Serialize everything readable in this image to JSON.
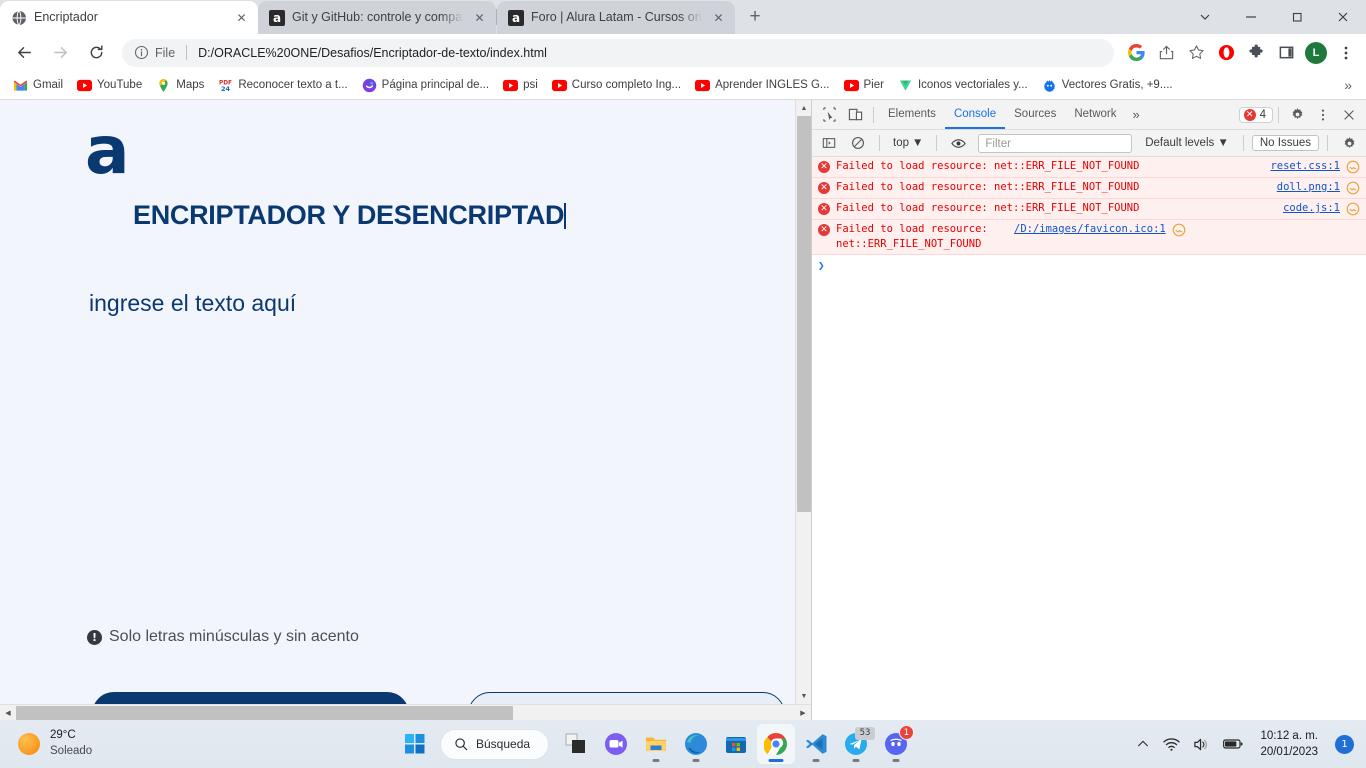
{
  "browser": {
    "tabs": [
      {
        "title": "Encriptador",
        "favicon": "globe-icon",
        "active": true
      },
      {
        "title": "Git y GitHub: controle y compartä",
        "favicon": "alura-icon",
        "active": false
      },
      {
        "title": "Foro | Alura Latam - Cursos onlin",
        "favicon": "alura-icon",
        "active": false
      }
    ],
    "new_tab_label": "+",
    "window_controls": {
      "minimize": "–",
      "maximize": "❐",
      "close": "✕",
      "chevron": "⌄"
    },
    "nav": {
      "back": "←",
      "forward": "→",
      "reload": "⟳"
    },
    "omnibox": {
      "info_icon": "info-circle-icon",
      "scheme_label": "File",
      "url": "D:/ORACLE%20ONE/Desafios/Encriptador-de-texto/index.html"
    },
    "toolbar_icons": [
      "google-icon",
      "share-icon",
      "bookmark-star-icon",
      "opera-gx-icon",
      "extensions-puzzle-icon",
      "side-panel-icon"
    ],
    "profile_initial": "L",
    "menu_icon": "three-dots-icon",
    "bookmarks": [
      {
        "label": "Gmail",
        "icon": "gmail-icon"
      },
      {
        "label": "YouTube",
        "icon": "youtube-icon"
      },
      {
        "label": "Maps",
        "icon": "maps-pin-icon"
      },
      {
        "label": "Reconocer texto a t...",
        "icon": "pdf24-icon"
      },
      {
        "label": "Página principal de...",
        "icon": "purple-circle-icon"
      },
      {
        "label": "psi",
        "icon": "youtube-icon"
      },
      {
        "label": "Curso completo Ing...",
        "icon": "youtube-icon"
      },
      {
        "label": "Aprender INGLES G...",
        "icon": "youtube-icon"
      },
      {
        "label": "Pier",
        "icon": "youtube-icon"
      },
      {
        "label": "Iconos vectoriales y...",
        "icon": "vuesax-icon"
      },
      {
        "label": "Vectores Gratis, +9....",
        "icon": "freepik-icon"
      }
    ],
    "bookmarks_overflow": "»"
  },
  "page": {
    "logo_letter": "a",
    "title": "ENCRIPTADOR Y DESENCRIPTAD",
    "input_value": "ingrese el texto aquí",
    "hint_icon": "exclamation-circle-icon",
    "hint_text": "Solo letras minúsculas y sin acento",
    "buttons": {
      "encrypt": "",
      "decrypt": ""
    },
    "colors": {
      "brand_blue": "#0a3871",
      "page_bg": "#f3f5fc"
    }
  },
  "devtools": {
    "inspect_icon": "cursor-select-icon",
    "device_icon": "device-toolbar-icon",
    "tabs": [
      "Elements",
      "Console",
      "Sources",
      "Network"
    ],
    "active_tab": "Console",
    "more_tabs": "»",
    "error_count": "4",
    "settings_icon": "gear-icon",
    "kebab_icon": "three-dots-icon",
    "close_icon": "close-icon",
    "filterbar": {
      "sidebar_icon": "console-sidebar-icon",
      "clear_icon": "clear-console-icon",
      "context": "top",
      "context_caret": "▼",
      "eye_icon": "live-expression-eye-icon",
      "filter_placeholder": "Filter",
      "levels": "Default levels",
      "levels_caret": "▼",
      "issues": "No Issues",
      "settings_icon": "gear-icon"
    },
    "logs": [
      {
        "icon": "error-circle-icon",
        "message": "Failed to load resource: net::ERR_FILE_NOT_FOUND",
        "source": "reset.css:1",
        "net_icon": "network-request-icon"
      },
      {
        "icon": "error-circle-icon",
        "message": "Failed to load resource: net::ERR_FILE_NOT_FOUND",
        "source": "doll.png:1",
        "net_icon": "network-request-icon"
      },
      {
        "icon": "error-circle-icon",
        "message": "Failed to load resource: net::ERR_FILE_NOT_FOUND",
        "source": "code.js:1",
        "net_icon": "network-request-icon"
      },
      {
        "icon": "error-circle-icon",
        "message": "Failed to load resource: net::ERR_FILE_NOT_FOUND",
        "source": "/D:/images/favicon.ico:1",
        "net_icon": "network-request-icon"
      }
    ],
    "prompt_symbol": "❯"
  },
  "taskbar": {
    "weather": {
      "temperature": "29°C",
      "condition": "Soleado",
      "icon": "sun-icon"
    },
    "start_icon": "windows-logo-icon",
    "search_label": "Búsqueda",
    "search_icon": "search-icon",
    "apps": [
      {
        "name": "task-view-icon",
        "running": false
      },
      {
        "name": "chat-teams-icon",
        "running": false
      },
      {
        "name": "file-explorer-icon",
        "running": true
      },
      {
        "name": "microsoft-edge-icon",
        "running": true
      },
      {
        "name": "microsoft-store-icon",
        "running": false
      },
      {
        "name": "google-chrome-icon",
        "running": true,
        "focused": true
      },
      {
        "name": "vscode-icon",
        "running": true
      },
      {
        "name": "telegram-icon",
        "running": true,
        "badge": "53"
      },
      {
        "name": "discord-icon",
        "running": true,
        "badge": "1"
      }
    ],
    "tray": {
      "chevron_icon": "chevron-up-icon",
      "wifi_icon": "wifi-icon",
      "volume_icon": "speaker-icon",
      "battery_icon": "battery-icon"
    },
    "clock": {
      "time": "10:12 a. m.",
      "date": "20/01/2023"
    },
    "notification_count": "1"
  }
}
